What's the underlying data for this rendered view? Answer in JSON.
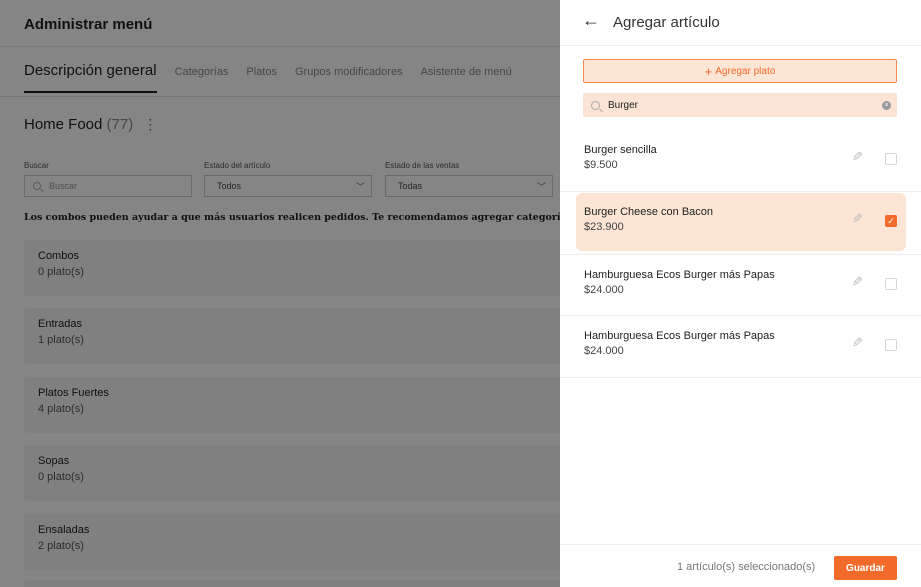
{
  "page": {
    "title": "Administrar menú",
    "tabs": [
      "Descripción general",
      "Categorías",
      "Platos",
      "Grupos modificadores",
      "Asistente de menú"
    ],
    "store": {
      "name": "Home Food",
      "count": "(77)"
    },
    "filters": {
      "search": {
        "label": "Buscar",
        "placeholder": "Buscar"
      },
      "item_status": {
        "label": "Estado del artículo",
        "value": "Todos"
      },
      "sales_status": {
        "label": "Estado de las ventas",
        "value": "Todas"
      }
    },
    "promo_text": "Los combos pueden ayudar a que más usuarios realicen pedidos. Te recomendamos agregar categorías de combos y",
    "categories": [
      {
        "name": "Combos",
        "count": "0 plato(s)"
      },
      {
        "name": "Entradas",
        "count": "1 plato(s)"
      },
      {
        "name": "Platos Fuertes",
        "count": "4 plato(s)"
      },
      {
        "name": "Sopas",
        "count": "0 plato(s)"
      },
      {
        "name": "Ensaladas",
        "count": "2 plato(s)"
      }
    ]
  },
  "drawer": {
    "title": "Agregar artículo",
    "add_button": "Agregar plato",
    "search_value": "Burger",
    "items": [
      {
        "name": "Burger sencilla",
        "price": "$9.500",
        "selected": false
      },
      {
        "name": "Burger Cheese con Bacon",
        "price": "$23.900",
        "selected": true
      },
      {
        "name": "Hamburguesa Ecos Burger más Papas",
        "price": "$24.000",
        "selected": false
      },
      {
        "name": "Hamburguesa Ecos Burger más Papas",
        "price": "$24.000",
        "selected": false
      }
    ],
    "footer_text": "1 artículo(s) seleccionado(s)",
    "save_label": "Guardar"
  },
  "icons": {
    "back": "arrow-left-icon",
    "kebab": "more-vertical-icon",
    "search": "search-icon",
    "clear": "clear-icon",
    "edit": "pencil-icon",
    "check": "checkmark-icon"
  },
  "colors": {
    "accent": "#f26b2a",
    "accent_light": "#fde5d6",
    "overlay": "rgba(0,0,0,0.48)"
  }
}
